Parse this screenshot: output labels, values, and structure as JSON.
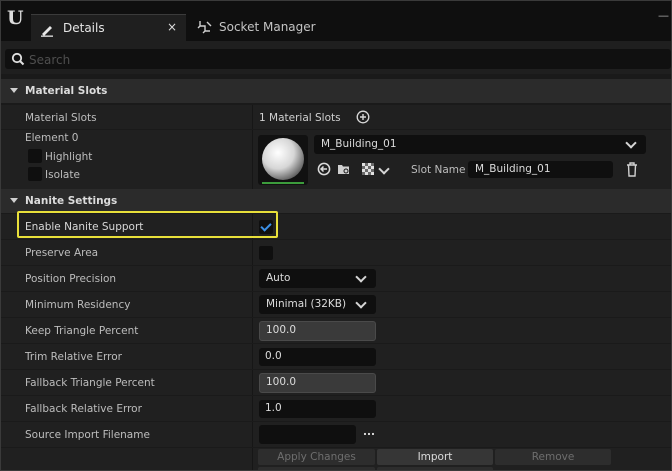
{
  "app": {
    "logo_text": "U"
  },
  "tabs": {
    "details": "Details",
    "details_close": "×",
    "socket_manager": "Socket Manager"
  },
  "window": {
    "minimize": "—"
  },
  "search": {
    "placeholder": "Search"
  },
  "material_slots_section": {
    "title": "Material Slots",
    "material_slots_label": "Material Slots",
    "material_slots_count": "1 Material Slots",
    "element_label": "Element 0",
    "highlight_label": "Highlight",
    "isolate_label": "Isolate",
    "material_name": "M_Building_01",
    "slot_name_label": "Slot Name",
    "slot_name_value": "M_Building_01"
  },
  "nanite_section": {
    "title": "Nanite Settings",
    "enable_label": "Enable Nanite Support",
    "enable_checked": true,
    "preserve_area_label": "Preserve Area",
    "position_precision_label": "Position Precision",
    "position_precision_value": "Auto",
    "minimum_residency_label": "Minimum Residency",
    "minimum_residency_value": "Minimal (32KB)",
    "keep_triangle_label": "Keep Triangle Percent",
    "keep_triangle_value": "100.0",
    "trim_error_label": "Trim Relative Error",
    "trim_error_value": "0.0",
    "fallback_triangle_label": "Fallback Triangle Percent",
    "fallback_triangle_value": "100.0",
    "fallback_error_label": "Fallback Relative Error",
    "fallback_error_value": "1.0",
    "source_import_label": "Source Import Filename",
    "source_import_value": "",
    "browse_label": "..."
  },
  "actions": {
    "apply": "Apply Changes",
    "import": "Import",
    "remove": "Remove"
  },
  "colors": {
    "highlight_border": "#e8df3a",
    "checkbox_check": "#3b8fe6",
    "material_bar": "#3c9c3c"
  }
}
